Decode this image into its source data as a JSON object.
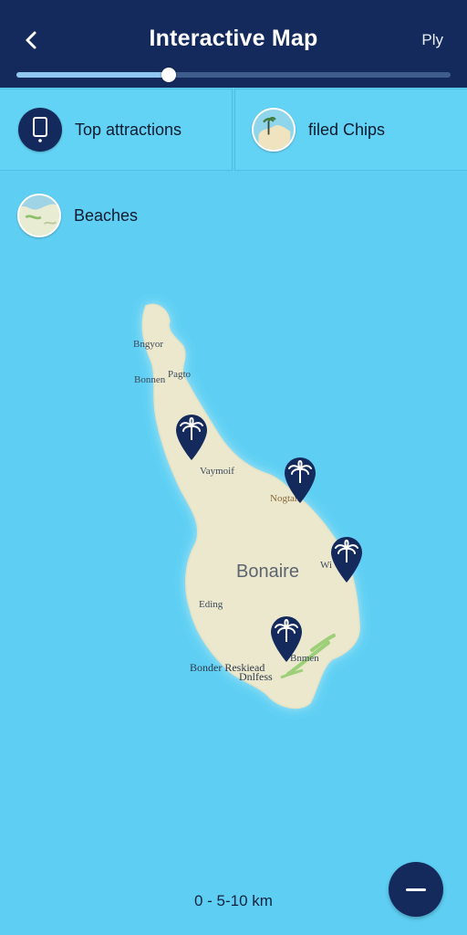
{
  "header": {
    "title": "Interactive Map",
    "action_label": "Ply",
    "slider_value": 0.35
  },
  "chips": [
    {
      "label": "Top attractions",
      "icon": "phone-icon"
    },
    {
      "label": "filed Chips",
      "icon": "map-thumbnail-icon"
    },
    {
      "label": "Beaches",
      "icon": "map-thumbnail-icon"
    }
  ],
  "map": {
    "island_name": "Bonaire",
    "places": [
      "Bngyor",
      "Bonnen",
      "Pagto",
      "Vaymoif",
      "Nogtan",
      "Wi",
      "Eding",
      "Bonder Reskiead",
      "Dnlfess",
      "Bnmen"
    ],
    "pins": [
      "palm-tree-pin",
      "palm-tree-pin",
      "palm-tree-pin",
      "palm-tree-pin"
    ]
  },
  "scale_label": "0 - 5-10 km",
  "colors": {
    "header": "#152a5c",
    "water": "#5ecff3",
    "land": "#ece9cf",
    "pin": "#152a5c"
  }
}
